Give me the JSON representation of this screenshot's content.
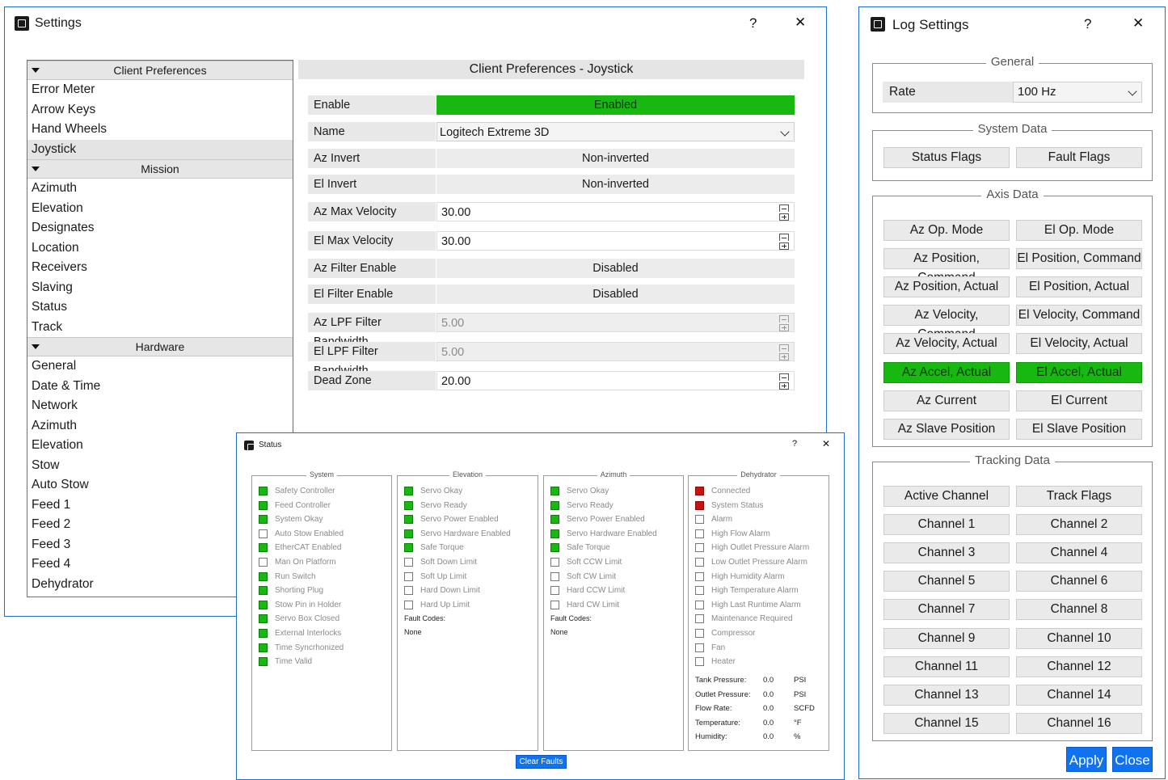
{
  "settings": {
    "title": "Settings",
    "help": "?",
    "close": "✕",
    "nav": {
      "group_client": "Client Preferences",
      "client_items": [
        "Error Meter",
        "Arrow Keys",
        "Hand Wheels",
        "Joystick"
      ],
      "group_mission": "Mission",
      "mission_items": [
        "Azimuth",
        "Elevation",
        "Designates",
        "Location",
        "Receivers",
        "Slaving",
        "Status",
        "Track"
      ],
      "group_hardware": "Hardware",
      "hardware_items": [
        "General",
        "Date & Time",
        "Network",
        "Azimuth",
        "Elevation",
        "Stow",
        "Auto Stow",
        "Feed 1",
        "Feed 2",
        "Feed 3",
        "Feed 4",
        "Dehydrator"
      ],
      "selected": "Joystick"
    },
    "panel": {
      "header": "Client Preferences - Joystick",
      "rows": [
        {
          "label": "Enable",
          "value": "Enabled"
        },
        {
          "label": "Name",
          "value": "Logitech Extreme 3D"
        },
        {
          "label": "Az Invert",
          "value": "Non-inverted"
        },
        {
          "label": "El Invert",
          "value": "Non-inverted"
        },
        {
          "label": "Az Max Velocity",
          "value": "30.00"
        },
        {
          "label": "El Max Velocity",
          "value": "30.00"
        },
        {
          "label": "Az Filter Enable",
          "value": "Disabled"
        },
        {
          "label": "El Filter Enable",
          "value": "Disabled"
        },
        {
          "label": "Az LPF Filter Bandwidth",
          "value": "5.00"
        },
        {
          "label": "El LPF Filter Bandwidth",
          "value": "5.00"
        },
        {
          "label": "Dead Zone",
          "value": "20.00"
        }
      ]
    }
  },
  "log": {
    "title": "Log Settings",
    "help": "?",
    "close": "✕",
    "general": {
      "title": "General",
      "rate_label": "Rate",
      "rate_value": "100 Hz"
    },
    "system": {
      "title": "System Data",
      "buttons": [
        "Status Flags",
        "Fault Flags"
      ]
    },
    "axis": {
      "title": "Axis Data",
      "buttons": [
        "Az Op. Mode",
        "El Op. Mode",
        "Az Position, Command",
        "El Position, Command",
        "Az Position, Actual",
        "El Position, Actual",
        "Az Velocity, Command",
        "El Velocity, Command",
        "Az Velocity, Actual",
        "El Velocity, Actual",
        "Az Accel, Actual",
        "El Accel, Actual",
        "Az Current",
        "El Current",
        "Az Slave Position",
        "El Slave Position"
      ]
    },
    "tracking": {
      "title": "Tracking Data",
      "buttons": [
        "Active Channel",
        "Track Flags",
        "Channel 1",
        "Channel 2",
        "Channel 3",
        "Channel 4",
        "Channel 5",
        "Channel 6",
        "Channel 7",
        "Channel 8",
        "Channel 9",
        "Channel 10",
        "Channel 11",
        "Channel 12",
        "Channel 13",
        "Channel 14",
        "Channel 15",
        "Channel 16"
      ]
    },
    "apply": "Apply",
    "close_btn": "Close",
    "colors": {
      "active_green": "#17b80f",
      "primary_blue": "#1172f0"
    }
  },
  "status": {
    "title": "Status",
    "help": "?",
    "close": "✕",
    "system": {
      "title": "System",
      "items": [
        {
          "label": "Safety Controller",
          "state": "green"
        },
        {
          "label": "Feed Controller",
          "state": "green"
        },
        {
          "label": "System Okay",
          "state": "green"
        },
        {
          "label": "Auto Stow Enabled",
          "state": "off"
        },
        {
          "label": "EtherCAT Enabled",
          "state": "green"
        },
        {
          "label": "Man On Platform",
          "state": "off"
        },
        {
          "label": "Run Switch",
          "state": "green"
        },
        {
          "label": "Shorting Plug",
          "state": "green"
        },
        {
          "label": "Stow Pin in Holder",
          "state": "green"
        },
        {
          "label": "Servo Box Closed",
          "state": "green"
        },
        {
          "label": "External Interlocks",
          "state": "green"
        },
        {
          "label": "Time Syncrhonized",
          "state": "green"
        },
        {
          "label": "Time Valid",
          "state": "green"
        }
      ]
    },
    "elevation": {
      "title": "Elevation",
      "items": [
        {
          "label": "Servo Okay",
          "state": "green"
        },
        {
          "label": "Servo Ready",
          "state": "green"
        },
        {
          "label": "Servo Power Enabled",
          "state": "green"
        },
        {
          "label": "Servo Hardware Enabled",
          "state": "green"
        },
        {
          "label": "Safe Torque",
          "state": "green"
        },
        {
          "label": "Soft Down Limit",
          "state": "off"
        },
        {
          "label": "Soft Up Limit",
          "state": "off"
        },
        {
          "label": "Hard Down Limit",
          "state": "off"
        },
        {
          "label": "Hard Up Limit",
          "state": "off"
        }
      ],
      "fault_label": "Fault Codes:",
      "fault_value": "None"
    },
    "azimuth": {
      "title": "Azimuth",
      "items": [
        {
          "label": "Servo Okay",
          "state": "green"
        },
        {
          "label": "Servo Ready",
          "state": "green"
        },
        {
          "label": "Servo Power Enabled",
          "state": "green"
        },
        {
          "label": "Servo Hardware Enabled",
          "state": "green"
        },
        {
          "label": "Safe Torque",
          "state": "green"
        },
        {
          "label": "Soft CCW Limit",
          "state": "off"
        },
        {
          "label": "Soft CW Limit",
          "state": "off"
        },
        {
          "label": "Hard CCW Limit",
          "state": "off"
        },
        {
          "label": "Hard CW Limit",
          "state": "off"
        }
      ],
      "fault_label": "Fault Codes:",
      "fault_value": "None"
    },
    "dehydrator": {
      "title": "Dehydrator",
      "items": [
        {
          "label": "Connected",
          "state": "red"
        },
        {
          "label": "System Status",
          "state": "red"
        },
        {
          "label": "Alarm",
          "state": "off"
        },
        {
          "label": "High Flow Alarm",
          "state": "off"
        },
        {
          "label": "High Outlet Pressure Alarm",
          "state": "off"
        },
        {
          "label": "Low Outlet Pressure Alarm",
          "state": "off"
        },
        {
          "label": "High Humidity Alarm",
          "state": "off"
        },
        {
          "label": "High Temperature Alarm",
          "state": "off"
        },
        {
          "label": "High Last Runtime Alarm",
          "state": "off"
        },
        {
          "label": "Maintenance Required",
          "state": "off"
        },
        {
          "label": "Compressor",
          "state": "off"
        },
        {
          "label": "Fan",
          "state": "off"
        },
        {
          "label": "Heater",
          "state": "off"
        }
      ],
      "readings": [
        {
          "label": "Tank Pressure:",
          "value": "0.0",
          "unit": "PSI"
        },
        {
          "label": "Outlet Pressure:",
          "value": "0.0",
          "unit": "PSI"
        },
        {
          "label": "Flow Rate:",
          "value": "0.0",
          "unit": "SCFD"
        },
        {
          "label": "Temperature:",
          "value": "0.0",
          "unit": "°F"
        },
        {
          "label": "Humidity:",
          "value": "0.0",
          "unit": "%"
        }
      ]
    },
    "clear_faults": "Clear Faults"
  }
}
